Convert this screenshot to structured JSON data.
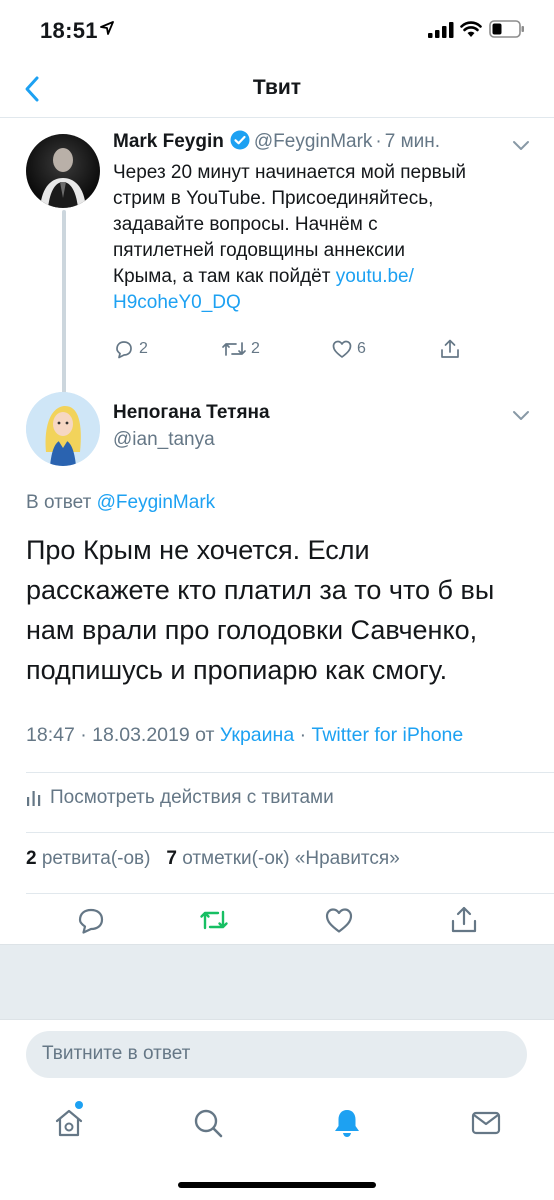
{
  "status_bar": {
    "time": "18:51"
  },
  "nav": {
    "title": "Твит"
  },
  "parent_tweet": {
    "author_name": "Mark Feygin",
    "handle": "@FeyginMark",
    "time": "7 мин.",
    "text_lines": [
      "Через 20 минут начинается мой первый",
      "стрим в YouTube. Присоединяйтесь,",
      "задавайте вопросы. Начнём с",
      "пятилетней годовщины аннексии",
      "Крыма, а там как пойдёт "
    ],
    "link_part1": "youtu.be/",
    "link_part2": "H9coheY0_DQ",
    "replies": "2",
    "retweets": "2",
    "likes": "6"
  },
  "reply_tweet": {
    "author_name": "Непогана Тетяна",
    "handle": "@ian_tanya",
    "reply_to_prefix": "В ответ",
    "reply_to_handle": "@FeyginMark",
    "text_lines": [
      "Про Крым не хочется. Если",
      "расскажете кто платил за то что б вы",
      "нам врали про голодовки Савченко,",
      "подпишусь и пропиарю как смогу."
    ],
    "timestamp": "18:47 · 18.03.2019 от",
    "location": "Украина",
    "separator": "·",
    "client": "Twitter for iPhone",
    "activity_label": "Посмотреть действия с твитами",
    "retweet_count": "2",
    "retweet_label": "ретвита(-ов)",
    "like_count": "7",
    "like_label": "отметки(-ок) «Нравится»"
  },
  "compose": {
    "placeholder": "Твитните в ответ"
  },
  "colors": {
    "accent": "#1da1f2",
    "retweet_green": "#17bf63",
    "muted": "#657786"
  },
  "tabbar": {
    "icons": [
      "home-icon",
      "search-icon",
      "notifications-bell-icon",
      "messages-mail-icon"
    ],
    "active": "notifications-bell-icon"
  }
}
